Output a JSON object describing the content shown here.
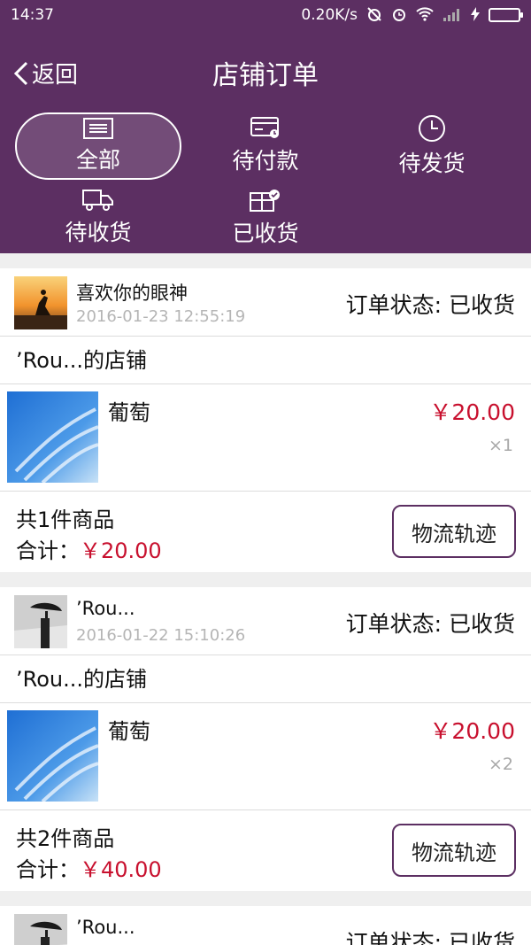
{
  "status_bar": {
    "time": "14:37",
    "network_speed": "0.20K/s",
    "icons": [
      "mute-alarm-icon",
      "alarm-clock-icon",
      "wifi-icon",
      "signal-icon",
      "charging-icon",
      "battery-icon"
    ]
  },
  "header": {
    "back_label": "返回",
    "title": "店铺订单",
    "background_color": "#5c2f62"
  },
  "tabs": [
    {
      "label": "全部",
      "icon": "list-icon",
      "active": true
    },
    {
      "label": "待付款",
      "icon": "card-clock-icon",
      "active": false
    },
    {
      "label": "待发货",
      "icon": "clock-icon",
      "active": false
    },
    {
      "label": "待收货",
      "icon": "truck-icon",
      "active": false
    },
    {
      "label": "已收货",
      "icon": "box-check-icon",
      "active": false
    }
  ],
  "orders": [
    {
      "buyer": "喜欢你的眼神",
      "time": "2016-01-23 12:55:19",
      "status_label": "订单状态:",
      "status": "已收货",
      "shop": "’Rou...的店铺",
      "item_name": "葡萄",
      "price": "￥20.00",
      "qty": "×1",
      "count_text": "共1件商品",
      "total_label": "合计：",
      "total": "￥20.00",
      "track_label": "物流轨迹"
    },
    {
      "buyer": "’Rou...",
      "time": "2016-01-22 15:10:26",
      "status_label": "订单状态:",
      "status": "已收货",
      "shop": "’Rou...的店铺",
      "item_name": "葡萄",
      "price": "￥20.00",
      "qty": "×2",
      "count_text": "共2件商品",
      "total_label": "合计：",
      "total": "￥40.00",
      "track_label": "物流轨迹"
    },
    {
      "buyer": "’Rou...",
      "status_label": "订单状态:",
      "status": "已收货"
    }
  ],
  "colors": {
    "accent": "#5c2f62",
    "price": "#c8102e",
    "muted": "#b5b5b5"
  }
}
